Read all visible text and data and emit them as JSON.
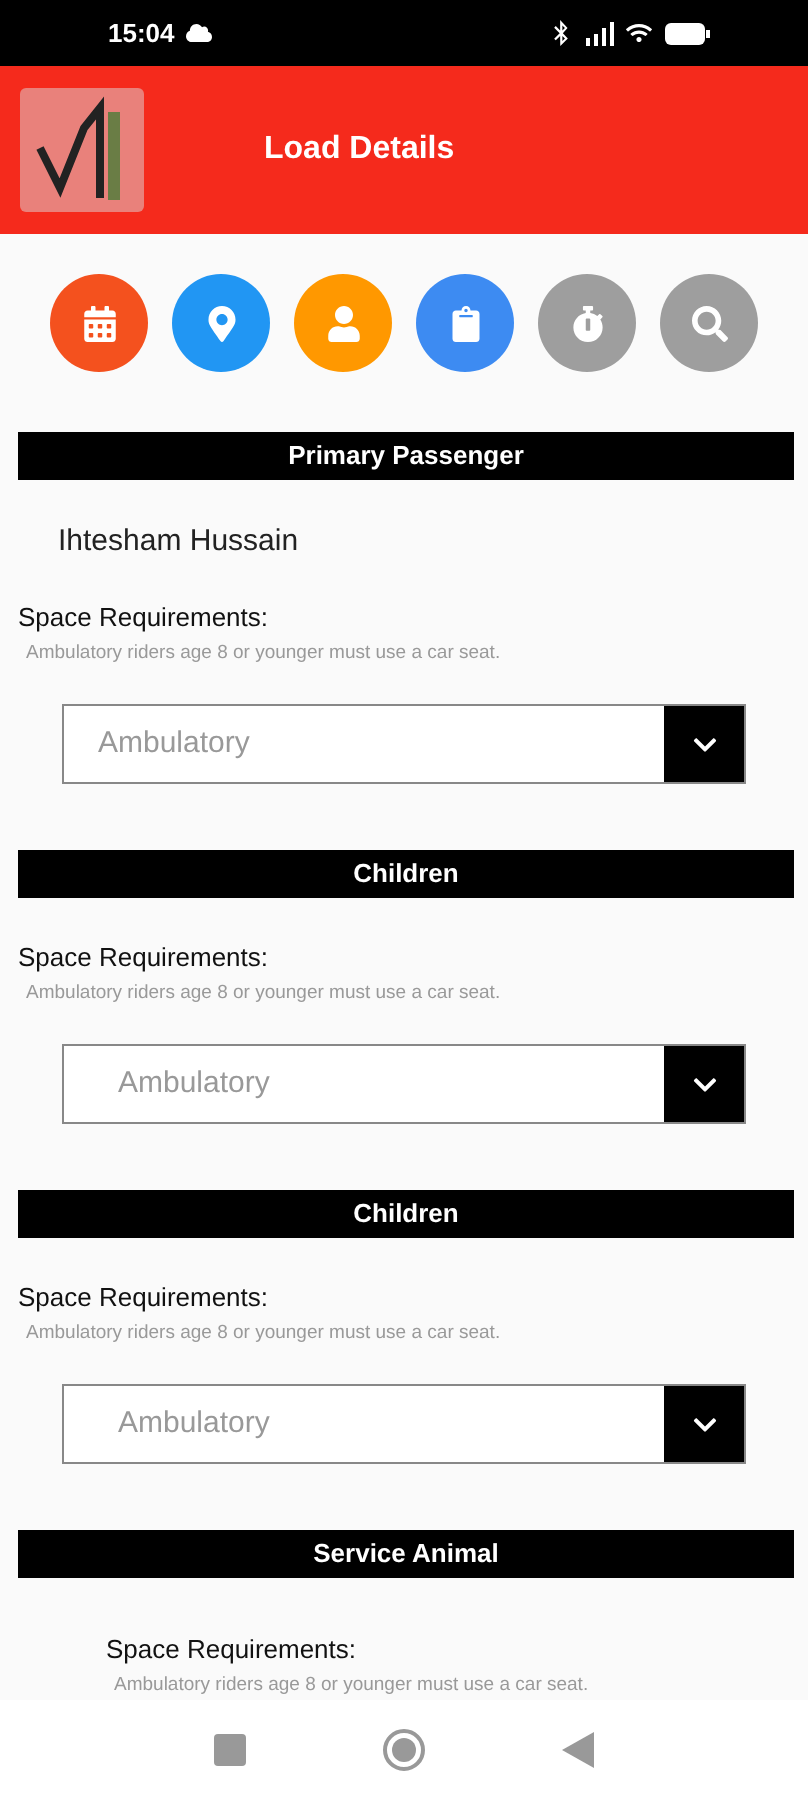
{
  "status_bar": {
    "time": "15:04"
  },
  "header": {
    "title": "Load Details"
  },
  "actions": [
    {
      "kind": "calendar",
      "color": "#f4511e"
    },
    {
      "kind": "location",
      "color": "#2196f3"
    },
    {
      "kind": "person",
      "color": "#ff9800"
    },
    {
      "kind": "clipboard",
      "color": "#3d8bf2"
    },
    {
      "kind": "timer",
      "color": "#9e9e9e"
    },
    {
      "kind": "search",
      "color": "#9e9e9e"
    }
  ],
  "sections": [
    {
      "title": "Primary Passenger",
      "name": "Ihtesham Hussain",
      "label": "Space Requirements:",
      "hint": "Ambulatory riders age 8 or younger must use a car seat.",
      "indented": false,
      "select": {
        "value": "Ambulatory"
      }
    },
    {
      "title": "Children",
      "label": "Space Requirements:",
      "hint": "Ambulatory riders age 8 or younger must use a car seat.",
      "indented": false,
      "select": {
        "value": "Ambulatory"
      }
    },
    {
      "title": "Children",
      "label": "Space Requirements:",
      "hint": "Ambulatory riders age 8 or younger must use a car seat.",
      "indented": false,
      "select": {
        "value": "Ambulatory"
      }
    },
    {
      "title": "Service Animal",
      "label": "Space Requirements:",
      "hint": "Ambulatory riders age 8 or younger must use a car seat.",
      "indented": true
    }
  ]
}
